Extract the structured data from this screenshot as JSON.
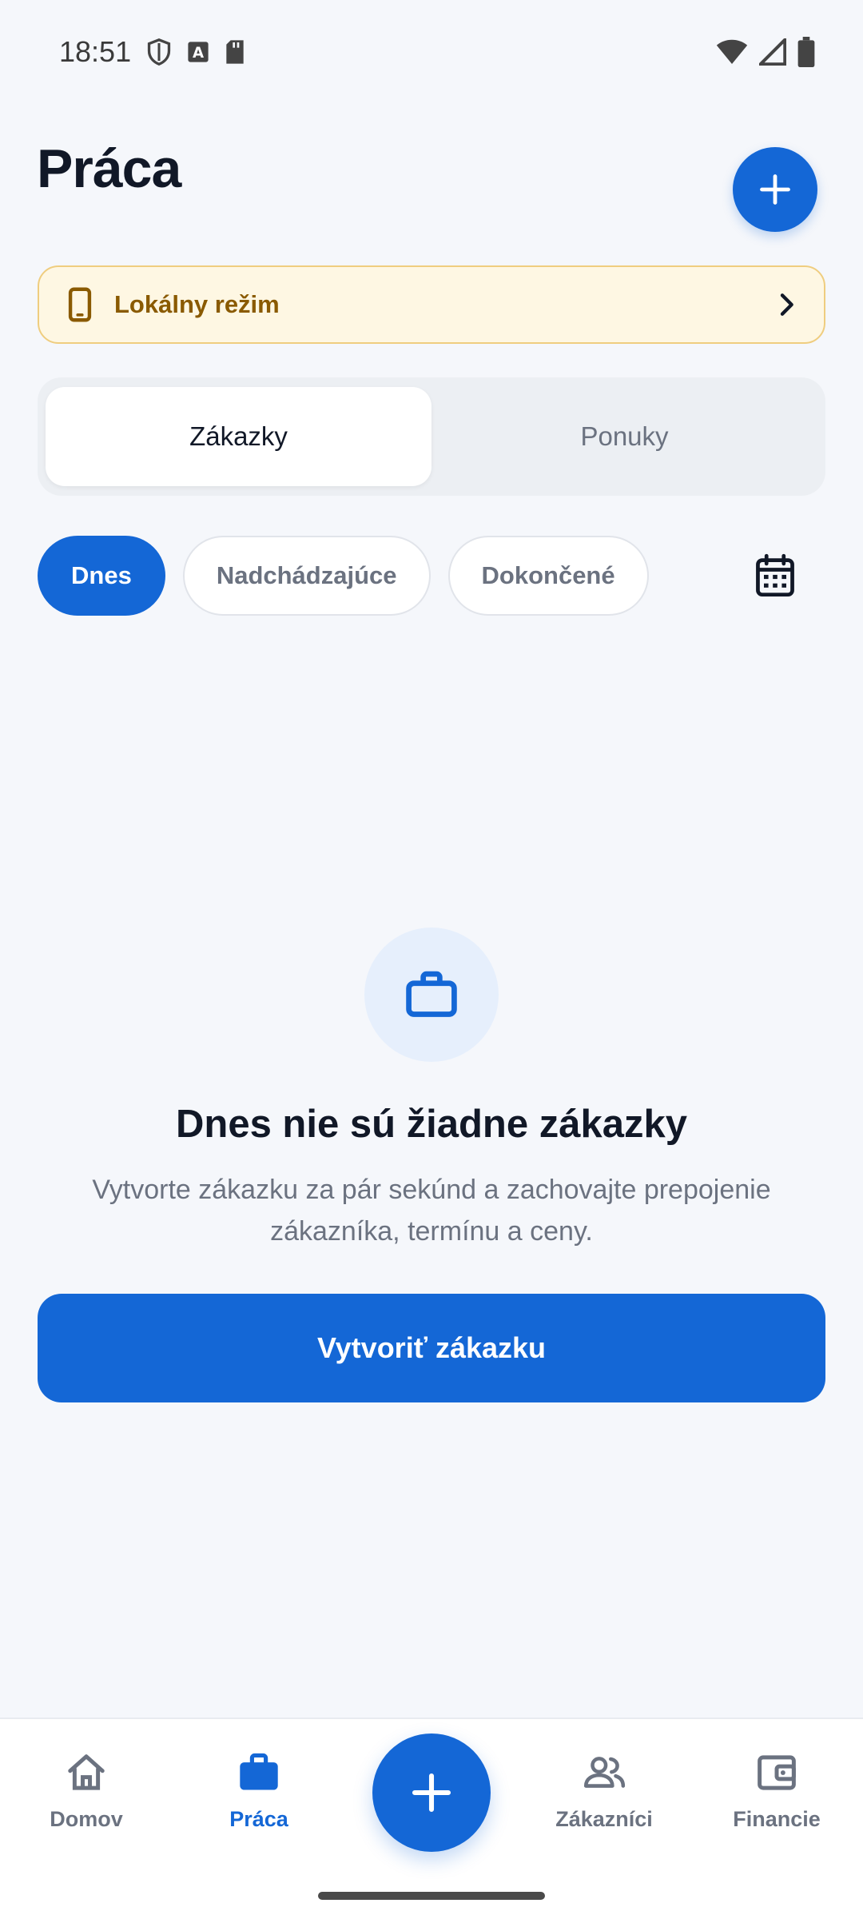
{
  "status_bar": {
    "time": "18:51",
    "left_icons": [
      "shield-icon",
      "a-box-icon",
      "sd-card-icon"
    ],
    "right_icons": [
      "wifi-icon",
      "signal-icon",
      "battery-icon"
    ]
  },
  "header": {
    "title": "Práca",
    "add_icon": "plus-icon"
  },
  "banner": {
    "icon": "phone-icon",
    "label": "Lokálny režim",
    "chevron": "chevron-right-icon",
    "background": "#fef7e3",
    "border": "#efcd7f",
    "text_color": "#8a5a00"
  },
  "segmented": {
    "options": [
      "Zákazky",
      "Ponuky"
    ],
    "selected": "Zákazky"
  },
  "filters": {
    "chips": [
      "Dnes",
      "Nadchádzajúce",
      "Dokončené"
    ],
    "selected": "Dnes",
    "calendar_icon": "calendar-icon"
  },
  "empty_state": {
    "icon": "briefcase-icon",
    "title": "Dnes nie sú žiadne zákazky",
    "description": "Vytvorte zákazku za pár sekúnd a zachovajte prepojenie zákazníka, termínu a ceny.",
    "button_label": "Vytvoriť zákazku"
  },
  "bottom_nav": {
    "items": [
      {
        "label": "Domov",
        "icon": "home-icon"
      },
      {
        "label": "Práca",
        "icon": "briefcase-icon"
      },
      {
        "label": "Zákazníci",
        "icon": "people-icon"
      },
      {
        "label": "Financie",
        "icon": "wallet-icon"
      }
    ],
    "active": "Práca",
    "fab_icon": "plus-icon"
  },
  "colors": {
    "accent": "#1467d6",
    "background": "#f5f7fb",
    "text_primary": "#111827",
    "text_secondary": "#6b7280"
  }
}
